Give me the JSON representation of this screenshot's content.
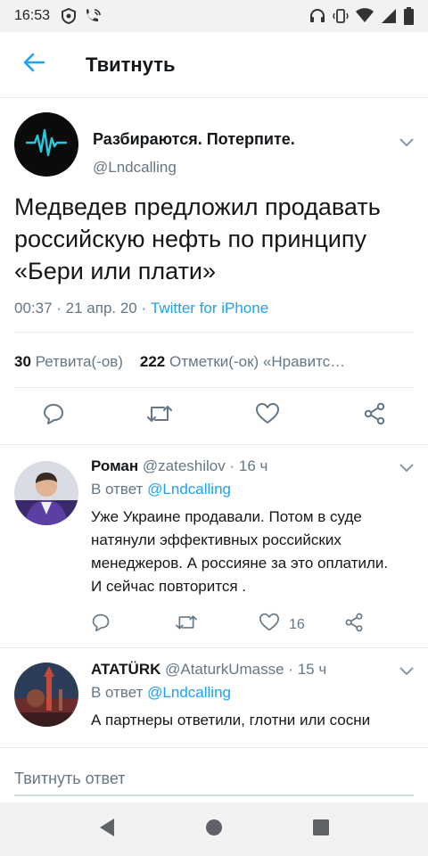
{
  "status_bar": {
    "time": "16:53",
    "icons_left": [
      "shield-icon",
      "phone-wifi-icon"
    ],
    "icons_right": [
      "headset-icon",
      "vibrate-icon",
      "wifi-icon",
      "signal-icon",
      "battery-icon"
    ]
  },
  "header": {
    "title": "Твитнуть",
    "back_icon": "arrow-left-icon"
  },
  "main_tweet": {
    "author_name": "Разбираются. Потерпите.",
    "author_handle": "@Lndcalling",
    "text": "Медведев предложил продавать российскую нефть по принципу «Бери или плати»",
    "time": "00:37",
    "sep1": " · ",
    "date": "21 апр. 20",
    "sep2": " · ",
    "source": "Twitter for iPhone",
    "retweets_count": "30",
    "retweets_label": "Ретвита(-ов)",
    "likes_count": "222",
    "likes_label": "Отметки(-ок) «Нравитс…"
  },
  "replies": [
    {
      "name": "Роман",
      "handle": "@zateshilov",
      "dot": " · ",
      "age": "16 ч",
      "reply_to_label": "В ответ ",
      "reply_to_mention": "@Lndcalling",
      "text": "Уже Украине продавали. Потом в суде натянули эффективных российских менеджеров. А россияне за это оплатили. И сейчас повторится .",
      "likes": "16"
    },
    {
      "name": "ATATÜRK",
      "handle": "@AtaturkUmasse",
      "dot": " · ",
      "age": "15 ч",
      "reply_to_label": "В ответ ",
      "reply_to_mention": "@Lndcalling",
      "text": "А партнеры ответили, глотни или сосни"
    }
  ],
  "compose": {
    "placeholder": "Твитнуть ответ"
  },
  "colors": {
    "accent": "#1da1f2",
    "secondary_text": "#657786",
    "divider": "#e6ecf0"
  }
}
